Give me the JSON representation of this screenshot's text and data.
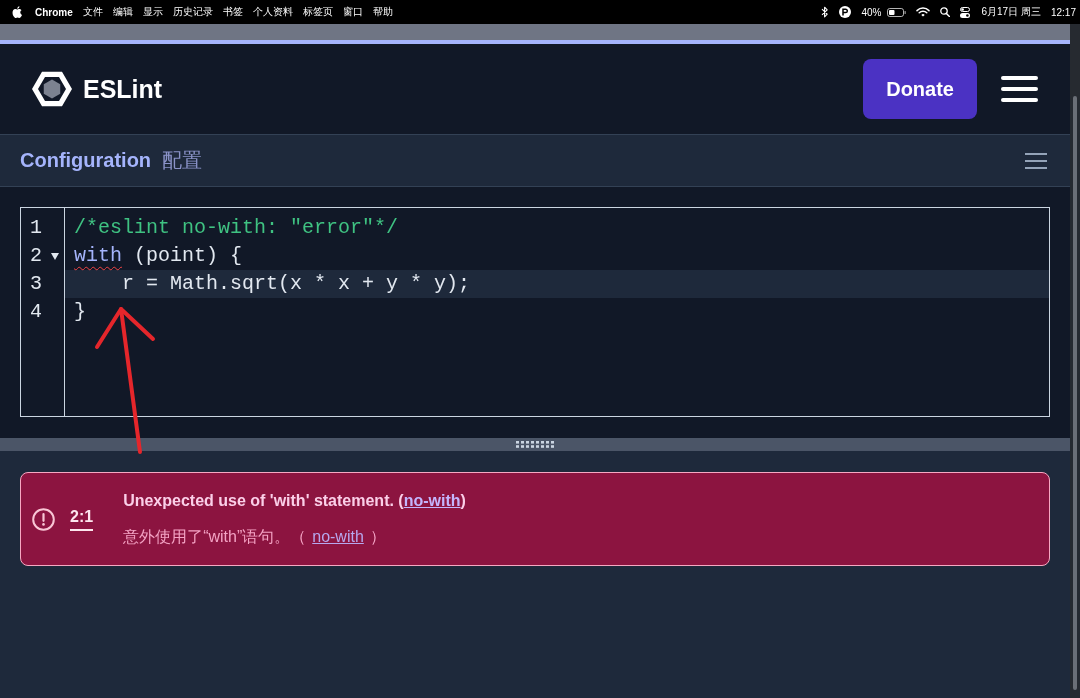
{
  "menu_bar": {
    "app_name": "Chrome",
    "menus": [
      "文件",
      "编辑",
      "显示",
      "历史记录",
      "书签",
      "个人资料",
      "标签页",
      "窗口",
      "帮助"
    ],
    "battery_percent": "40%",
    "date": "6月17日 周三",
    "time": "12:17"
  },
  "header": {
    "logo_text": "ESLint",
    "donate_button": "Donate"
  },
  "section": {
    "title": "Configuration",
    "title_translation": "配置"
  },
  "editor": {
    "lines": [
      {
        "number": "1",
        "foldable": false,
        "active": false,
        "tokens": [
          {
            "kind": "comment",
            "text": "/*eslint no-with: \"error\"*/",
            "error": false
          }
        ]
      },
      {
        "number": "2",
        "foldable": true,
        "active": false,
        "tokens": [
          {
            "kind": "keyword",
            "text": "with",
            "error": true
          },
          {
            "kind": "plain",
            "text": " (point) {",
            "error": false
          }
        ]
      },
      {
        "number": "3",
        "foldable": false,
        "active": true,
        "tokens": [
          {
            "kind": "plain",
            "text": "    r = Math.sqrt(x * x + y * y);",
            "error": false
          }
        ]
      },
      {
        "number": "4",
        "foldable": false,
        "active": false,
        "tokens": [
          {
            "kind": "plain",
            "text": "}",
            "error": false
          }
        ]
      }
    ]
  },
  "problems": [
    {
      "position": "2:1",
      "message": {
        "before": "Unexpected use of 'with' statement. (",
        "link": "no-with",
        "after": ")"
      },
      "translation": {
        "before": "意外使用了“with”语句。（",
        "link": "no-with",
        "after": "）"
      }
    }
  ]
}
